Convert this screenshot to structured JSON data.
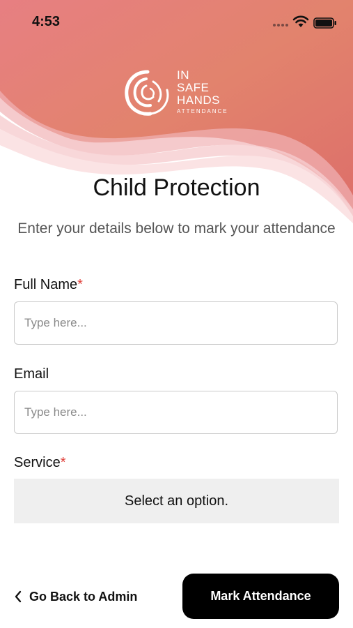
{
  "status_bar": {
    "time": "4:53"
  },
  "brand": {
    "line1": "IN",
    "line2": "SAFE",
    "line3": "HANDS",
    "tagline": "ATTENDANCE",
    "gradient_start": "#e58a6a",
    "gradient_end": "#dd6a78"
  },
  "page": {
    "title": "Child Protection",
    "subtitle": "Enter your details below to mark your attendance"
  },
  "form": {
    "full_name": {
      "label": "Full Name",
      "required_mark": "*",
      "placeholder": "Type here...",
      "value": ""
    },
    "email": {
      "label": "Email",
      "placeholder": "Type here...",
      "value": ""
    },
    "service": {
      "label": "Service",
      "required_mark": "*",
      "selected": "Select an option."
    }
  },
  "footer": {
    "back_label": "Go Back to Admin",
    "primary_label": "Mark Attendance"
  }
}
